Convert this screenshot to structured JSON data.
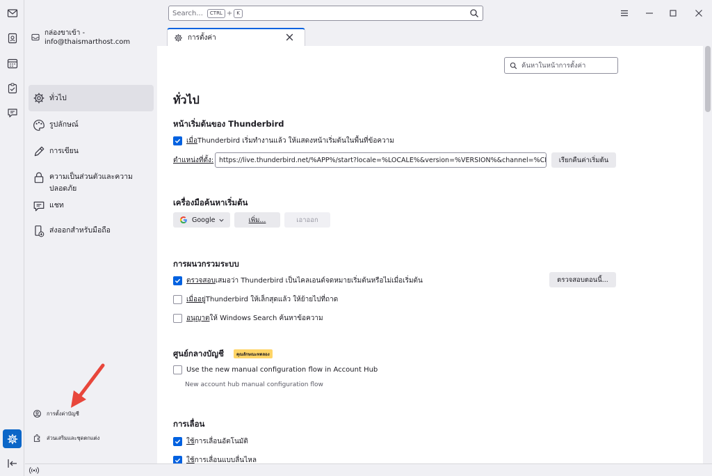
{
  "titlebar": {
    "search_placeholder": "Search...",
    "search_key1": "CTRL",
    "search_plus": "+",
    "search_key2": "K"
  },
  "tabs": [
    {
      "label": "กล่องขาเข้า - info@thaismarthost.com"
    },
    {
      "label": "การตั้งค่า"
    }
  ],
  "categories": [
    {
      "label": "ทั่วไป"
    },
    {
      "label": "รูปลักษณ์"
    },
    {
      "label": "การเขียน"
    },
    {
      "label": "ความเป็นส่วนตัวและความปลอดภัย"
    },
    {
      "label": "แชท"
    },
    {
      "label": "ส่งออกสำหรับมือถือ"
    }
  ],
  "bottom_nav": {
    "account_settings": "การตั้งค่าบัญชี",
    "addons": "ส่วนเสริมและชุดตกแต่ง"
  },
  "find_placeholder": "ค้นหาในหน้าการตั้งค่า",
  "main": {
    "title": "ทั่วไป",
    "start_page": {
      "heading": "หน้าเริ่มต้นของ Thunderbird",
      "checkbox_label_u": "เมื่อ",
      "checkbox_label_rest": " Thunderbird เริ่มทำงานแล้ว ให้แสดงหน้าเริ่มต้นในพื้นที่ข้อความ",
      "checkbox_checked": true,
      "location_label": "ตำแหน่งที่ตั้ง:",
      "location_value": "https://live.thunderbird.net/%APP%/start?locale=%LOCALE%&version=%VERSION%&channel=%CH/",
      "restore_button": "เรียกคืนค่าเริ่มต้น"
    },
    "search_engine": {
      "heading": "เครื่องมือค้นหาเริ่มต้น",
      "engine": "Google",
      "add_button": "เพิ่ม...",
      "remove_button": "เอาออก"
    },
    "system_integration": {
      "heading": "การผนวกรวมระบบ",
      "items": [
        {
          "label_u": "ตรวจสอบ",
          "label_rest": "เสมอว่า Thunderbird เป็นไคลเอนต์จดหมายเริ่มต้นหรือไม่เมื่อเริ่มต้น",
          "checked": true
        },
        {
          "label_u": "เมื่ออยู่",
          "label_rest": " Thunderbird ให้เล็กสุดแล้ว ให้ย้ายไปที่ถาด",
          "checked": false
        },
        {
          "label_u": "อนุญาต",
          "label_rest": "ให้ Windows Search ค้นหาข้อความ",
          "checked": false
        }
      ],
      "check_now_button": "ตรวจสอบตอนนี้..."
    },
    "account_hub": {
      "heading": "ศูนย์กลางบัญชี",
      "badge": "คุณลักษณะทดลอง",
      "checkbox_label": "Use the new manual configuration flow in Account Hub",
      "checkbox_checked": false,
      "description": "New account hub manual configuration flow"
    },
    "scrolling": {
      "heading": "การเลื่อน",
      "items": [
        {
          "label_u": "ใช้",
          "label_rest": "การเลื่อนอัตโนมัติ",
          "checked": true
        },
        {
          "label_u": "ใช้",
          "label_rest": "การเลื่อนแบบลื่นไหล",
          "checked": true
        }
      ]
    }
  },
  "colors": {
    "accent": "#0061e0",
    "arrow": "#e8463b",
    "badge": "#ffd567"
  }
}
